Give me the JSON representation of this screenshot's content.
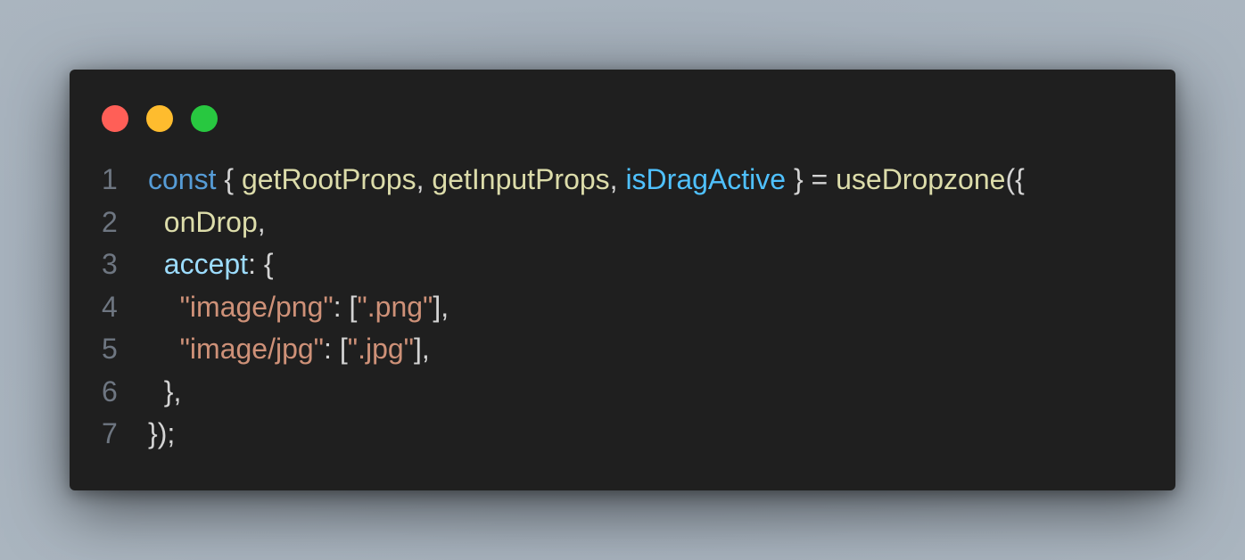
{
  "window": {
    "controls": [
      {
        "name": "close-button",
        "color": "#ff5f57"
      },
      {
        "name": "minimize-button",
        "color": "#febc2e"
      },
      {
        "name": "maximize-button",
        "color": "#28c840"
      }
    ]
  },
  "colors": {
    "keyword": "#569cd6",
    "function": "#dcdcaa",
    "variable": "#9cdcfe",
    "variable_bright": "#4fc1ff",
    "string": "#ce9178",
    "punctuation": "#d4d4d4",
    "line_number": "#6e7681"
  },
  "code": {
    "lines": [
      {
        "number": "1",
        "tokens": [
          {
            "text": "const",
            "kind": "keyword"
          },
          {
            "text": " { ",
            "kind": "punctuation"
          },
          {
            "text": "getRootProps",
            "kind": "function"
          },
          {
            "text": ", ",
            "kind": "punctuation"
          },
          {
            "text": "getInputProps",
            "kind": "function"
          },
          {
            "text": ", ",
            "kind": "punctuation"
          },
          {
            "text": "isDragActive",
            "kind": "variable_bright"
          },
          {
            "text": " } = ",
            "kind": "punctuation"
          },
          {
            "text": "useDropzone",
            "kind": "function"
          },
          {
            "text": "({",
            "kind": "punctuation"
          }
        ]
      },
      {
        "number": "2",
        "tokens": [
          {
            "text": "  ",
            "kind": "punctuation"
          },
          {
            "text": "onDrop",
            "kind": "function"
          },
          {
            "text": ",",
            "kind": "punctuation"
          }
        ]
      },
      {
        "number": "3",
        "tokens": [
          {
            "text": "  ",
            "kind": "punctuation"
          },
          {
            "text": "accept",
            "kind": "variable"
          },
          {
            "text": ": {",
            "kind": "punctuation"
          }
        ]
      },
      {
        "number": "4",
        "tokens": [
          {
            "text": "    ",
            "kind": "punctuation"
          },
          {
            "text": "\"image/png\"",
            "kind": "string"
          },
          {
            "text": ": [",
            "kind": "punctuation"
          },
          {
            "text": "\".png\"",
            "kind": "string"
          },
          {
            "text": "],",
            "kind": "punctuation"
          }
        ]
      },
      {
        "number": "5",
        "tokens": [
          {
            "text": "    ",
            "kind": "punctuation"
          },
          {
            "text": "\"image/jpg\"",
            "kind": "string"
          },
          {
            "text": ": [",
            "kind": "punctuation"
          },
          {
            "text": "\".jpg\"",
            "kind": "string"
          },
          {
            "text": "],",
            "kind": "punctuation"
          }
        ]
      },
      {
        "number": "6",
        "tokens": [
          {
            "text": "  },",
            "kind": "punctuation"
          }
        ]
      },
      {
        "number": "7",
        "tokens": [
          {
            "text": "});",
            "kind": "punctuation"
          }
        ]
      }
    ]
  }
}
